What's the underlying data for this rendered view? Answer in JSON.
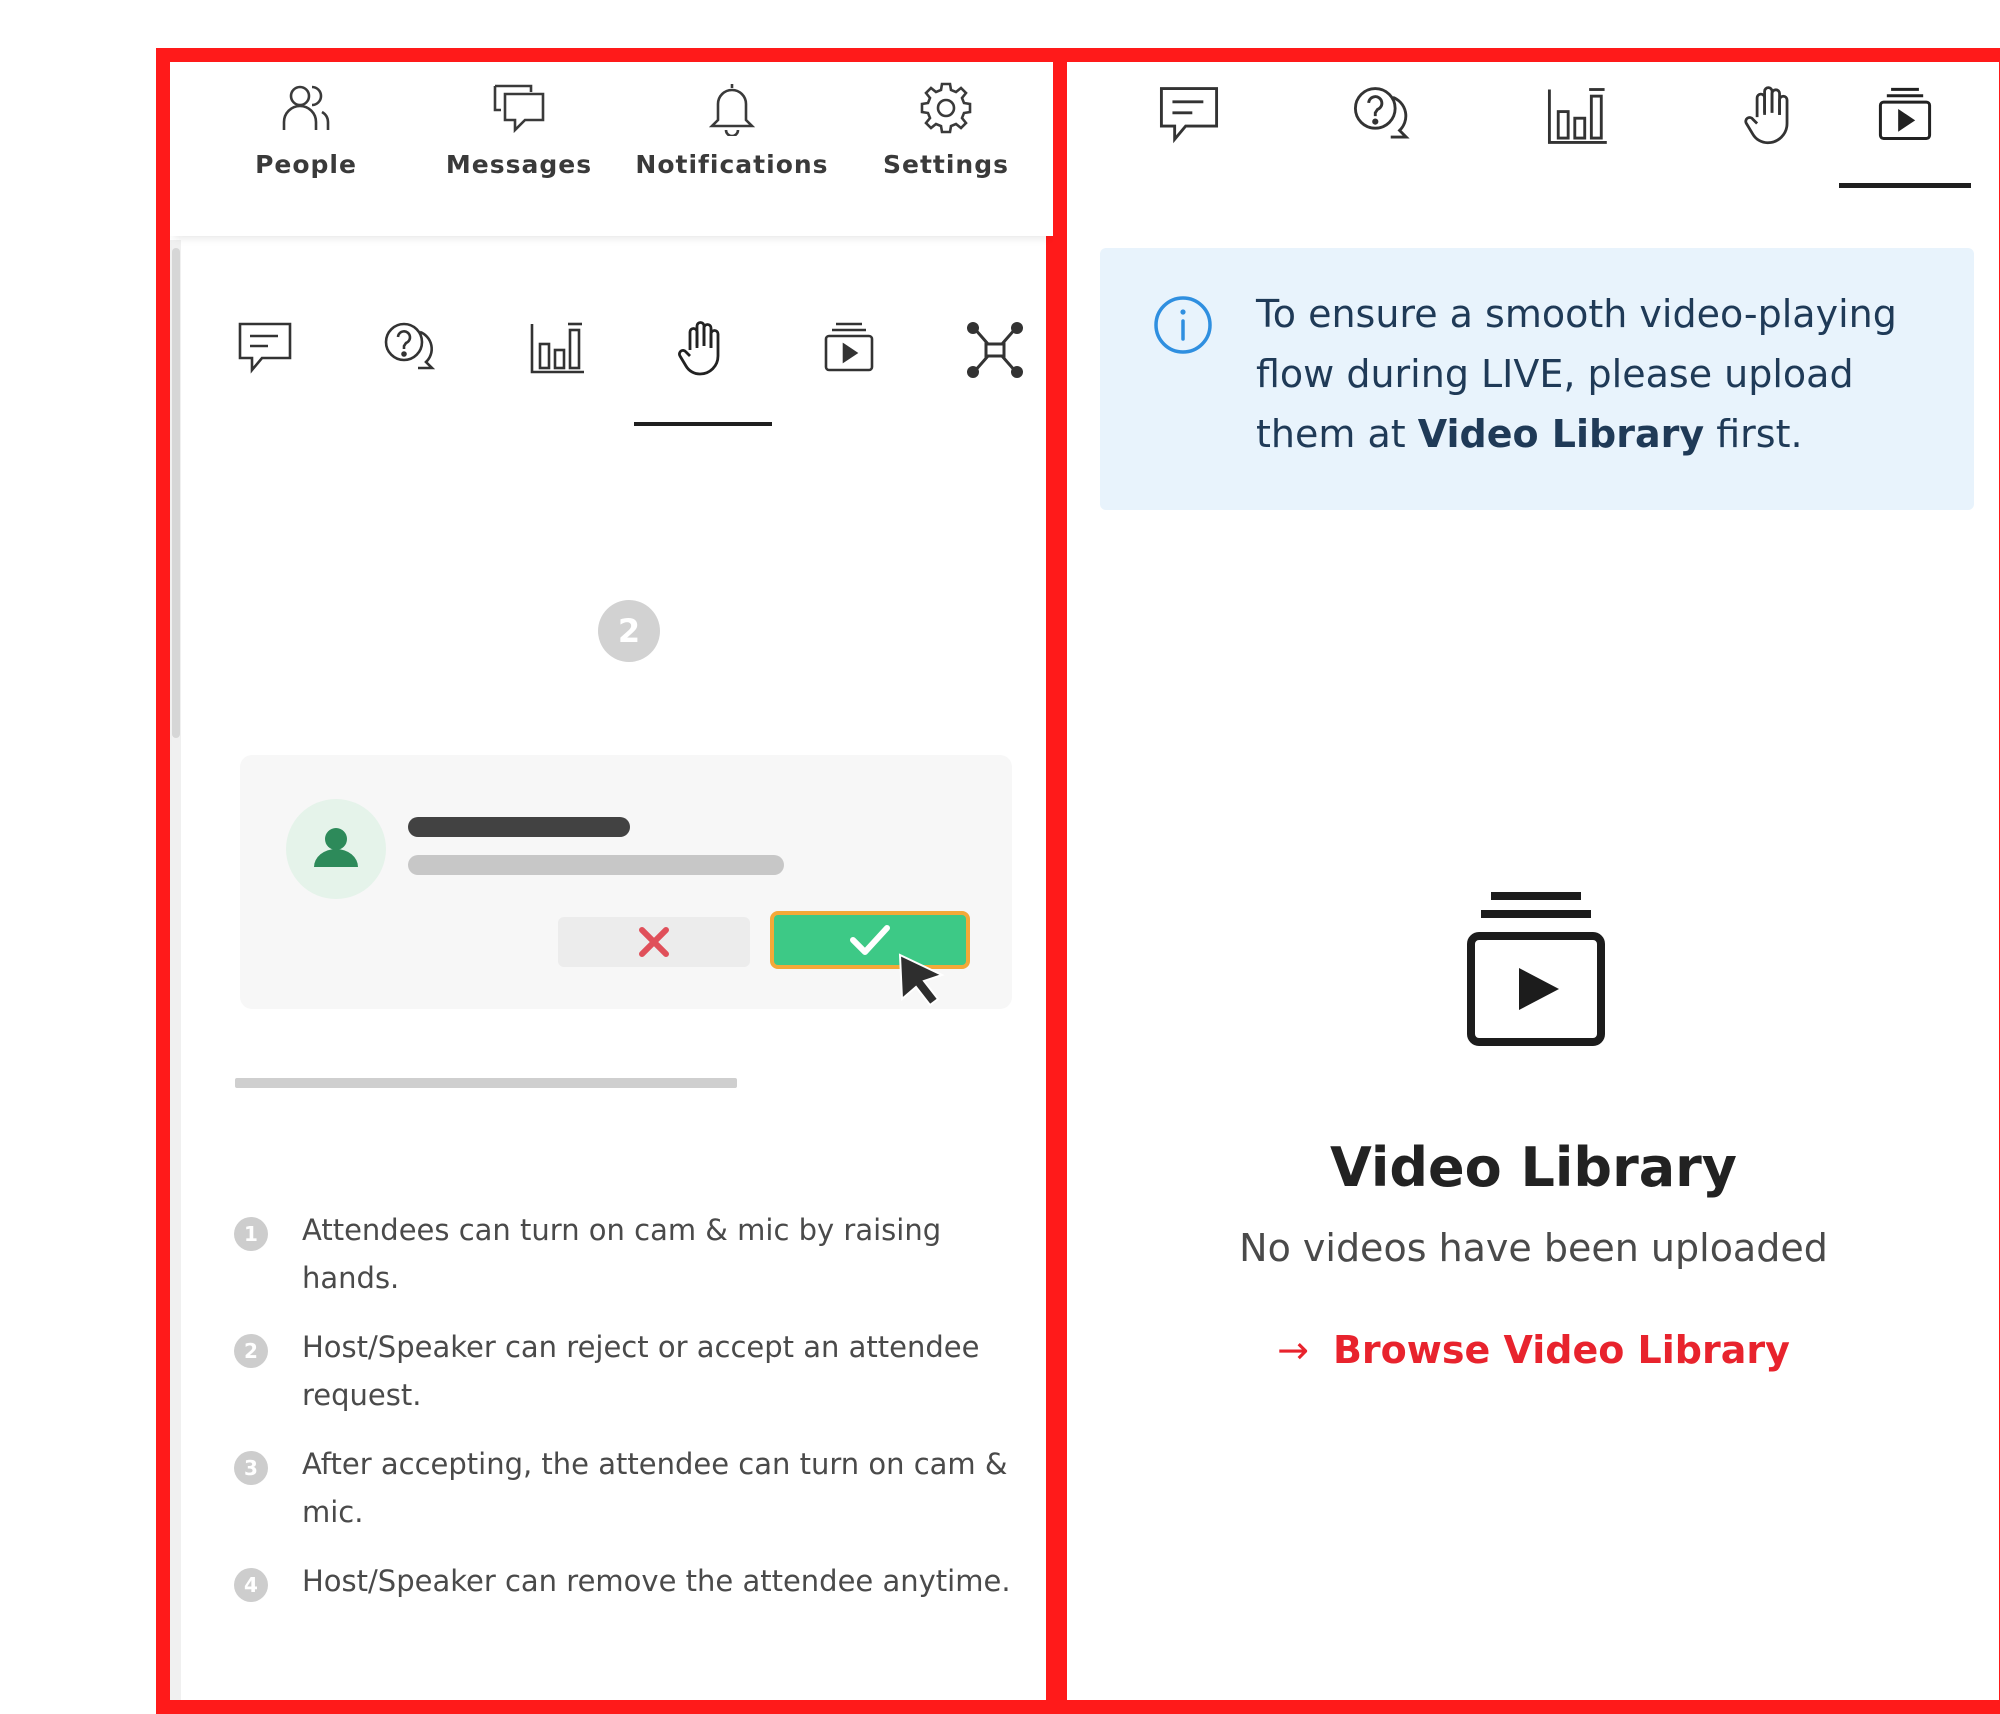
{
  "top_nav": {
    "items": [
      {
        "label": "People",
        "icon": "people-icon"
      },
      {
        "label": "Messages",
        "icon": "messages-icon"
      },
      {
        "label": "Notifications",
        "icon": "bell-icon"
      },
      {
        "label": "Settings",
        "icon": "gear-icon"
      }
    ]
  },
  "left_tabs": {
    "items": [
      {
        "icon": "chat-icon",
        "active": false
      },
      {
        "icon": "qa-icon",
        "active": false
      },
      {
        "icon": "poll-icon",
        "active": false
      },
      {
        "icon": "raise-hand-icon",
        "active": true
      },
      {
        "icon": "video-library-icon",
        "active": false
      },
      {
        "icon": "network-icon",
        "active": false
      }
    ]
  },
  "raise_hand": {
    "step_badge": "2",
    "steps": [
      {
        "num": "1",
        "text": "Attendees can turn on cam & mic by raising hands."
      },
      {
        "num": "2",
        "text": "Host/Speaker can reject or accept an attendee request."
      },
      {
        "num": "3",
        "text": "After accepting, the attendee can turn on cam & mic."
      },
      {
        "num": "4",
        "text": "Host/Speaker can remove the attendee anytime."
      }
    ]
  },
  "right_tabs": {
    "items": [
      {
        "icon": "chat-icon",
        "active": false
      },
      {
        "icon": "qa-icon",
        "active": false
      },
      {
        "icon": "poll-icon",
        "active": false
      },
      {
        "icon": "raise-hand-icon",
        "active": false
      },
      {
        "icon": "video-library-icon",
        "active": true
      }
    ]
  },
  "video_library": {
    "info_part1": "To ensure a smooth video-playing flow during LIVE, please upload them at ",
    "info_bold": "Video Library",
    "info_part2": " first.",
    "title": "Video Library",
    "subtitle": "No videos have been uploaded",
    "link_arrow": "→",
    "link_label": "Browse Video Library"
  },
  "colors": {
    "frame": "#ff1a1a",
    "accept_green": "#3dc986",
    "accept_outline": "#f4a938",
    "reject_x": "#e0505a",
    "info_bg": "#e8f3fc",
    "info_icon": "#2f8fe0",
    "link_red": "#e8232d"
  }
}
